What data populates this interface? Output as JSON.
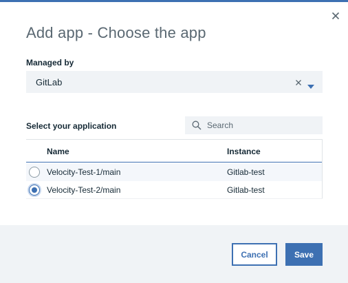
{
  "dialog": {
    "title": "Add app - Choose the app",
    "managed_by_label": "Managed by",
    "managed_by_value": "GitLab",
    "select_label": "Select your application",
    "search_placeholder": "Search"
  },
  "table": {
    "columns": [
      "Name",
      "Instance"
    ],
    "rows": [
      {
        "name": "Velocity-Test-1/main",
        "instance": "Gitlab-test",
        "selected": false
      },
      {
        "name": "Velocity-Test-2/main",
        "instance": "Gitlab-test",
        "selected": true
      }
    ]
  },
  "footer": {
    "cancel_label": "Cancel",
    "save_label": "Save"
  },
  "icons": {
    "close": "close-icon",
    "clear": "clear-icon",
    "caret": "chevron-down-icon",
    "search": "search-icon"
  },
  "colors": {
    "accent": "#3d70b2",
    "text": "#152935",
    "field_bg": "#f0f3f6"
  }
}
